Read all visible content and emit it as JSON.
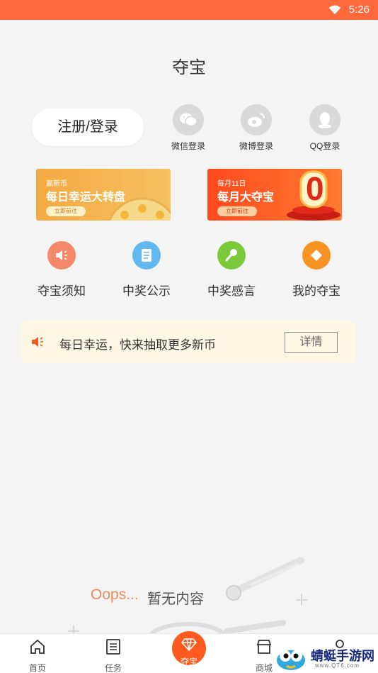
{
  "status_bar": {
    "time": "5:26"
  },
  "page": {
    "title": "夺宝"
  },
  "login": {
    "button_label": "注册/登录",
    "social": [
      {
        "label": "微信登录",
        "icon": "wechat-icon"
      },
      {
        "label": "微博登录",
        "icon": "weibo-icon"
      },
      {
        "label": "QQ登录",
        "icon": "qq-icon"
      }
    ]
  },
  "banners": [
    {
      "small": "赢新币",
      "big": "每日幸运大转盘",
      "button": "立即前往"
    },
    {
      "small": "每月11日",
      "big": "每月大夺宝",
      "button": "立即前往",
      "badge": "0"
    }
  ],
  "features": [
    {
      "label": "夺宝须知",
      "icon": "speaker-icon",
      "color": "#f4896a"
    },
    {
      "label": "中奖公示",
      "icon": "document-icon",
      "color": "#62b9f0"
    },
    {
      "label": "中奖感言",
      "icon": "microphone-icon",
      "color": "#7ac93a"
    },
    {
      "label": "我的夺宝",
      "icon": "diamond-icon",
      "color": "#f79320"
    }
  ],
  "notice": {
    "text": "每日幸运，快来抽取更多新币",
    "button": "详情"
  },
  "empty_state": {
    "oops": "Oops...",
    "message": "暂无内容"
  },
  "tabbar": {
    "tabs": [
      {
        "label": "首页",
        "icon": "home-icon"
      },
      {
        "label": "任务",
        "icon": "list-icon"
      },
      {
        "label": "夺宝",
        "icon": "diamond-icon"
      },
      {
        "label": "商城",
        "icon": "shop-icon"
      },
      {
        "label": "",
        "icon": "user-icon"
      }
    ]
  },
  "watermark": {
    "text": "蜻蜓手游网",
    "url": "www.QT6.com"
  },
  "colors": {
    "accent": "#ff6a3d",
    "background": "#f4f4f4",
    "notice_bg": "#fdf7e3"
  }
}
